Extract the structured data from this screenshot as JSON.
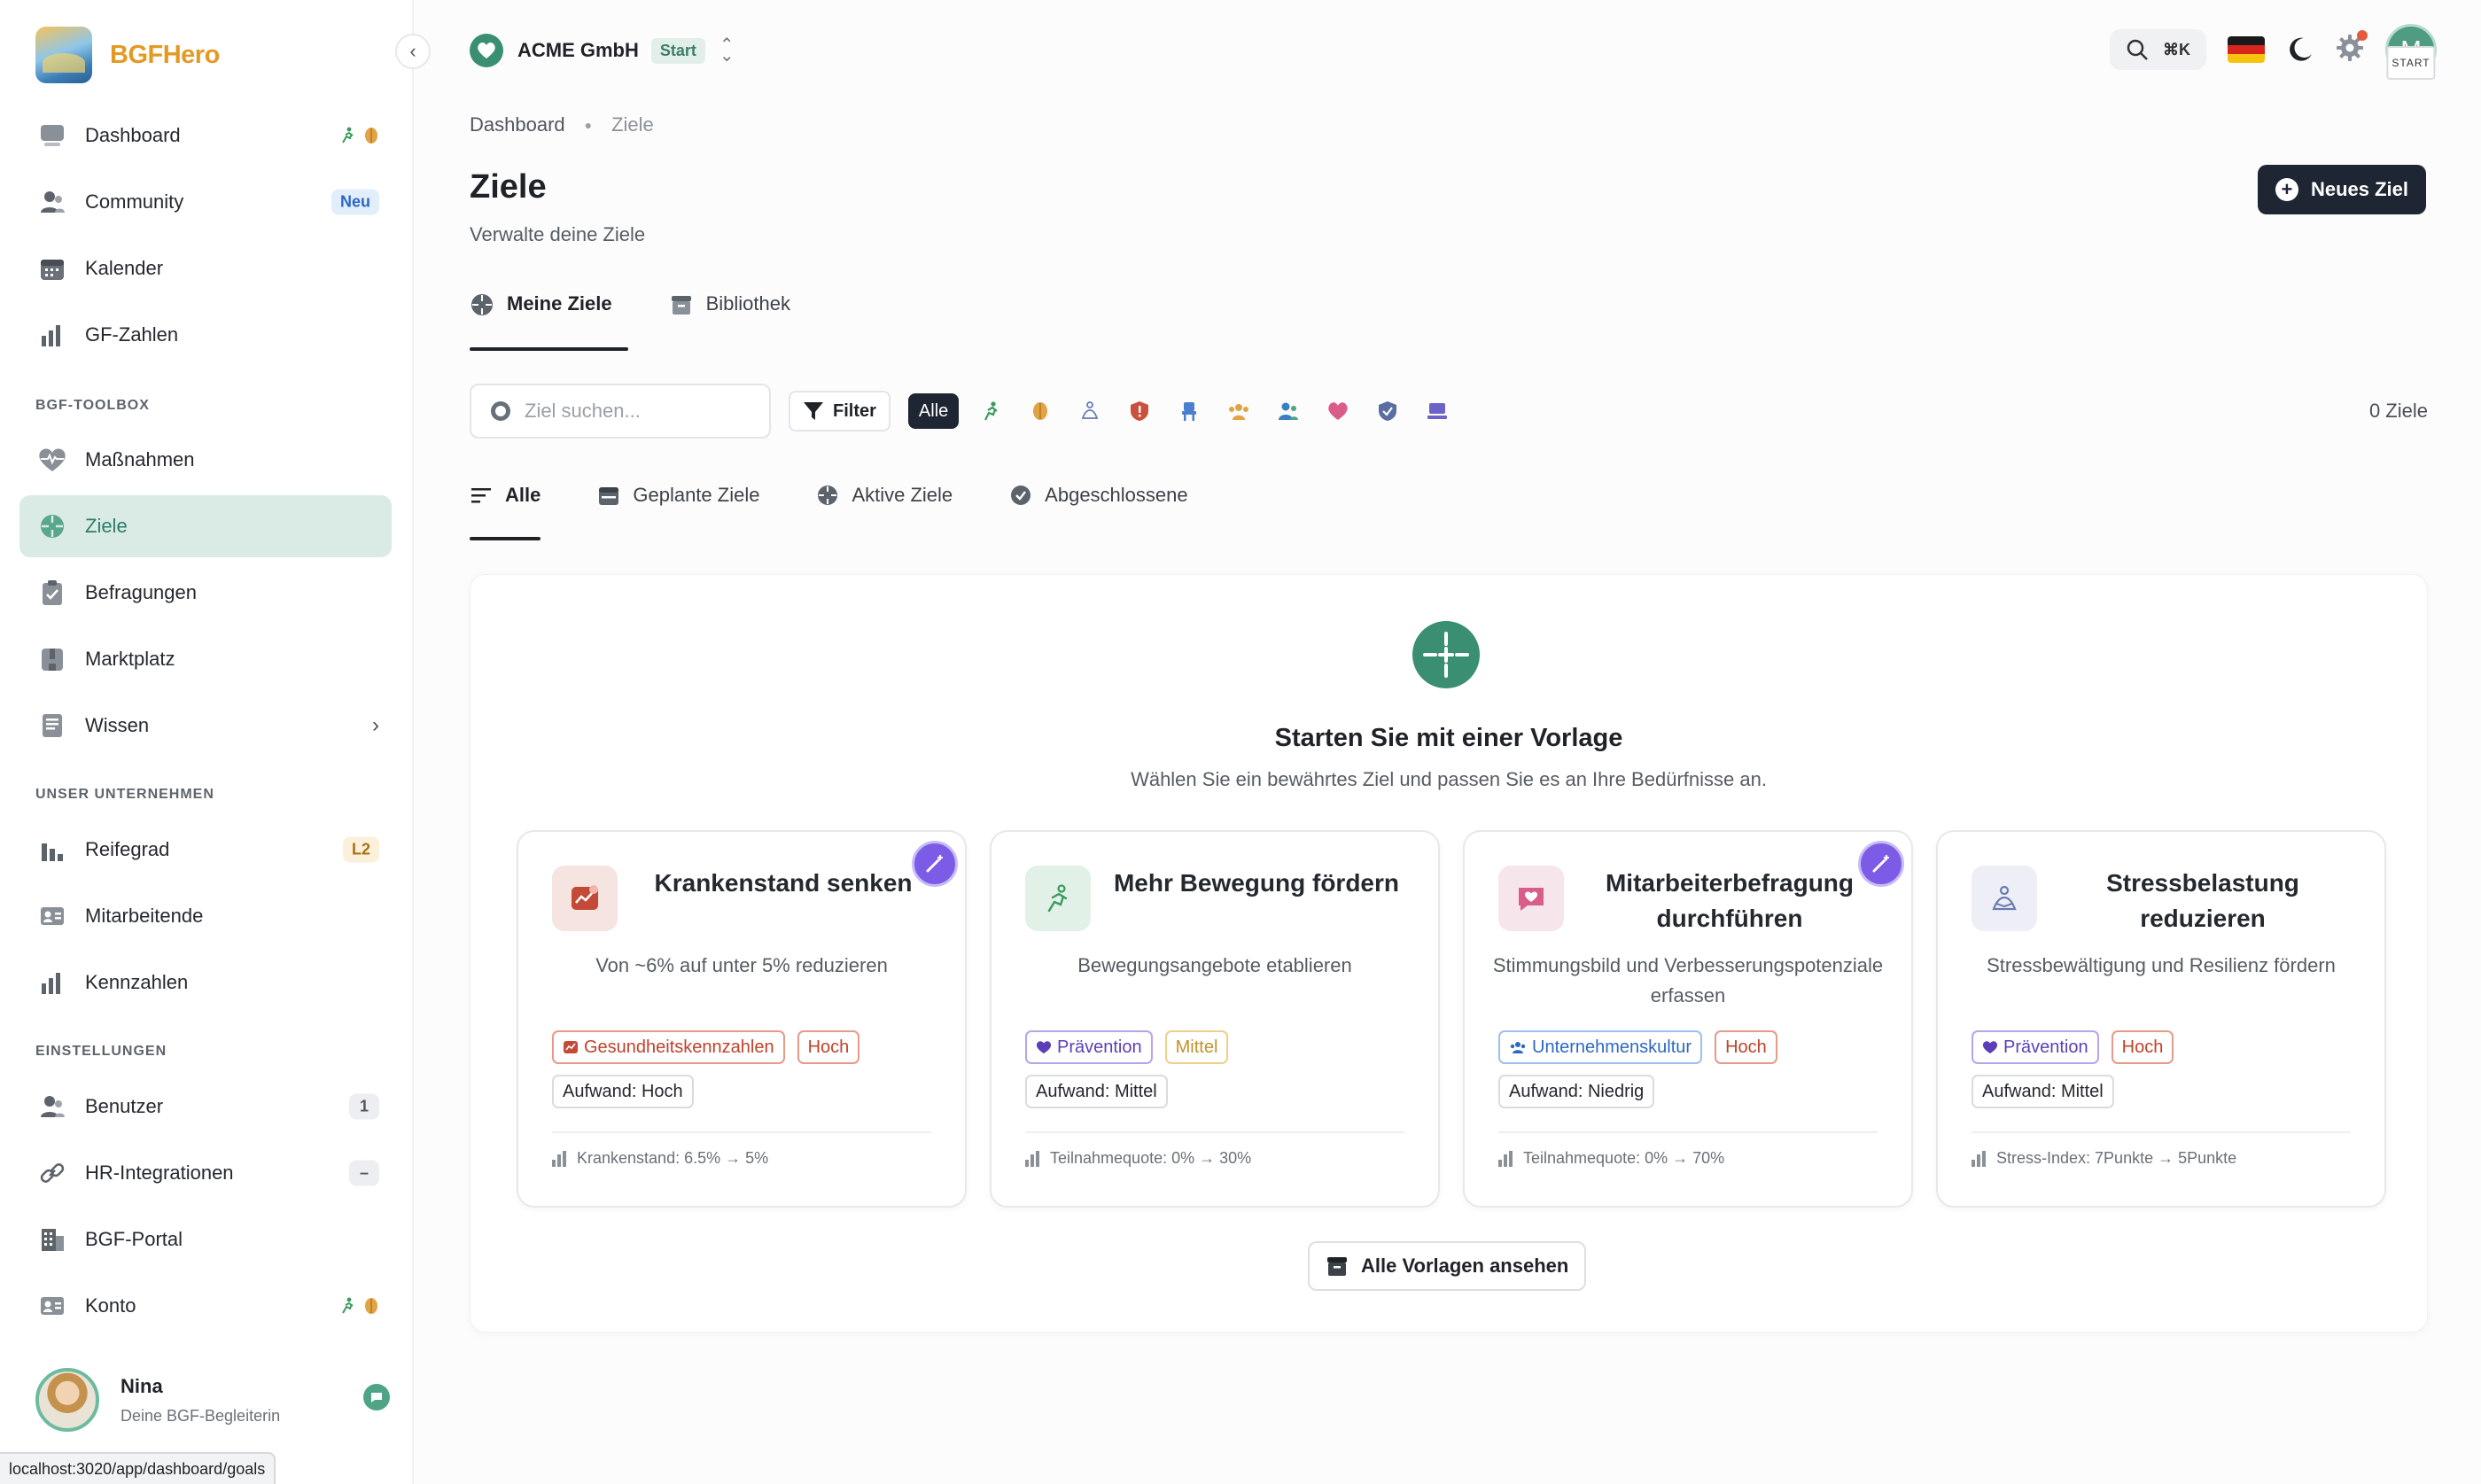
{
  "brand": {
    "name": "BGFHero"
  },
  "sidebar": {
    "items": [
      {
        "label": "Dashboard",
        "icon": "dashboard-icon"
      },
      {
        "label": "Community",
        "icon": "community-icon",
        "badge": "Neu"
      },
      {
        "label": "Kalender",
        "icon": "calendar-icon"
      },
      {
        "label": "GF-Zahlen",
        "icon": "bar-chart-icon"
      }
    ],
    "toolbox_label": "BGF-TOOLBOX",
    "toolbox": [
      {
        "label": "Maßnahmen",
        "icon": "heartbeat-icon"
      },
      {
        "label": "Ziele",
        "icon": "target-icon",
        "active": true
      },
      {
        "label": "Befragungen",
        "icon": "clipboard-check-icon"
      },
      {
        "label": "Marktplatz",
        "icon": "store-icon"
      },
      {
        "label": "Wissen",
        "icon": "book-icon"
      }
    ],
    "company_label": "UNSER UNTERNEHMEN",
    "company": [
      {
        "label": "Reifegrad",
        "icon": "bar-chart-icon",
        "badge": "L2"
      },
      {
        "label": "Mitarbeitende",
        "icon": "id-card-icon"
      },
      {
        "label": "Kennzahlen",
        "icon": "bar-chart-icon"
      }
    ],
    "settings_label": "EINSTELLUNGEN",
    "settings": [
      {
        "label": "Benutzer",
        "icon": "users-icon",
        "badge": "1"
      },
      {
        "label": "HR-Integrationen",
        "icon": "link-icon",
        "badge": "–"
      },
      {
        "label": "BGF-Portal",
        "icon": "building-icon"
      },
      {
        "label": "Konto",
        "icon": "id-card-icon"
      }
    ],
    "assistant": {
      "name": "Nina",
      "role": "Deine BGF-Begleiterin"
    }
  },
  "status_url": "localhost:3020/app/dashboard/goals",
  "topbar": {
    "org_name": "ACME GmbH",
    "org_badge": "Start",
    "shortcut": "⌘K",
    "avatar_initial": "M",
    "avatar_tag": "START"
  },
  "breadcrumb": {
    "root": "Dashboard",
    "current": "Ziele"
  },
  "page": {
    "title": "Ziele",
    "subtitle": "Verwalte deine Ziele",
    "new_button": "Neues Ziel"
  },
  "tabs": [
    {
      "label": "Meine Ziele",
      "active": true
    },
    {
      "label": "Bibliothek",
      "active": false
    }
  ],
  "filters": {
    "search_placeholder": "Ziel suchen...",
    "filter_label": "Filter",
    "all_label": "Alle",
    "count": "0 Ziele"
  },
  "subtabs": [
    {
      "label": "Alle",
      "active": true
    },
    {
      "label": "Geplante Ziele"
    },
    {
      "label": "Aktive Ziele"
    },
    {
      "label": "Abgeschlossene"
    }
  ],
  "empty_state": {
    "title": "Starten Sie mit einer Vorlage",
    "subtitle": "Wählen Sie ein bewährtes Ziel und passen Sie es an Ihre Bedürfnisse an.",
    "all_button": "Alle Vorlagen ansehen"
  },
  "templates": [
    {
      "title": "Krankenstand senken",
      "description": "Von ~6% auf unter 5% reduzieren",
      "category": "Gesundheitskennzahlen",
      "priority": "Hoch",
      "effort": "Aufwand: Hoch",
      "metric": "Krankenstand: 6.5% → 5%"
    },
    {
      "title": "Mehr Bewegung fördern",
      "description": "Bewegungsangebote etablieren",
      "category": "Prävention",
      "priority": "Mittel",
      "effort": "Aufwand: Mittel",
      "metric": "Teilnahmequote: 0% → 30%"
    },
    {
      "title": "Mitarbeiterbefragung durchführen",
      "description": "Stimmungsbild und Verbesserungspotenziale erfassen",
      "category": "Unternehmenskultur",
      "priority": "Hoch",
      "effort": "Aufwand: Niedrig",
      "metric": "Teilnahmequote: 0% → 70%"
    },
    {
      "title": "Stressbelastung reduzieren",
      "description": "Stressbewältigung und Resilienz fördern",
      "category": "Prävention",
      "priority": "Hoch",
      "effort": "Aufwand: Mittel",
      "metric": "Stress-Index: 7Punkte → 5Punkte"
    }
  ],
  "colors": {
    "accent": "#3a8f72",
    "active_bg": "#d9ebe4",
    "brand": "#e39a25",
    "primary_button": "#1e2533",
    "magic": "#7c5ce6"
  }
}
